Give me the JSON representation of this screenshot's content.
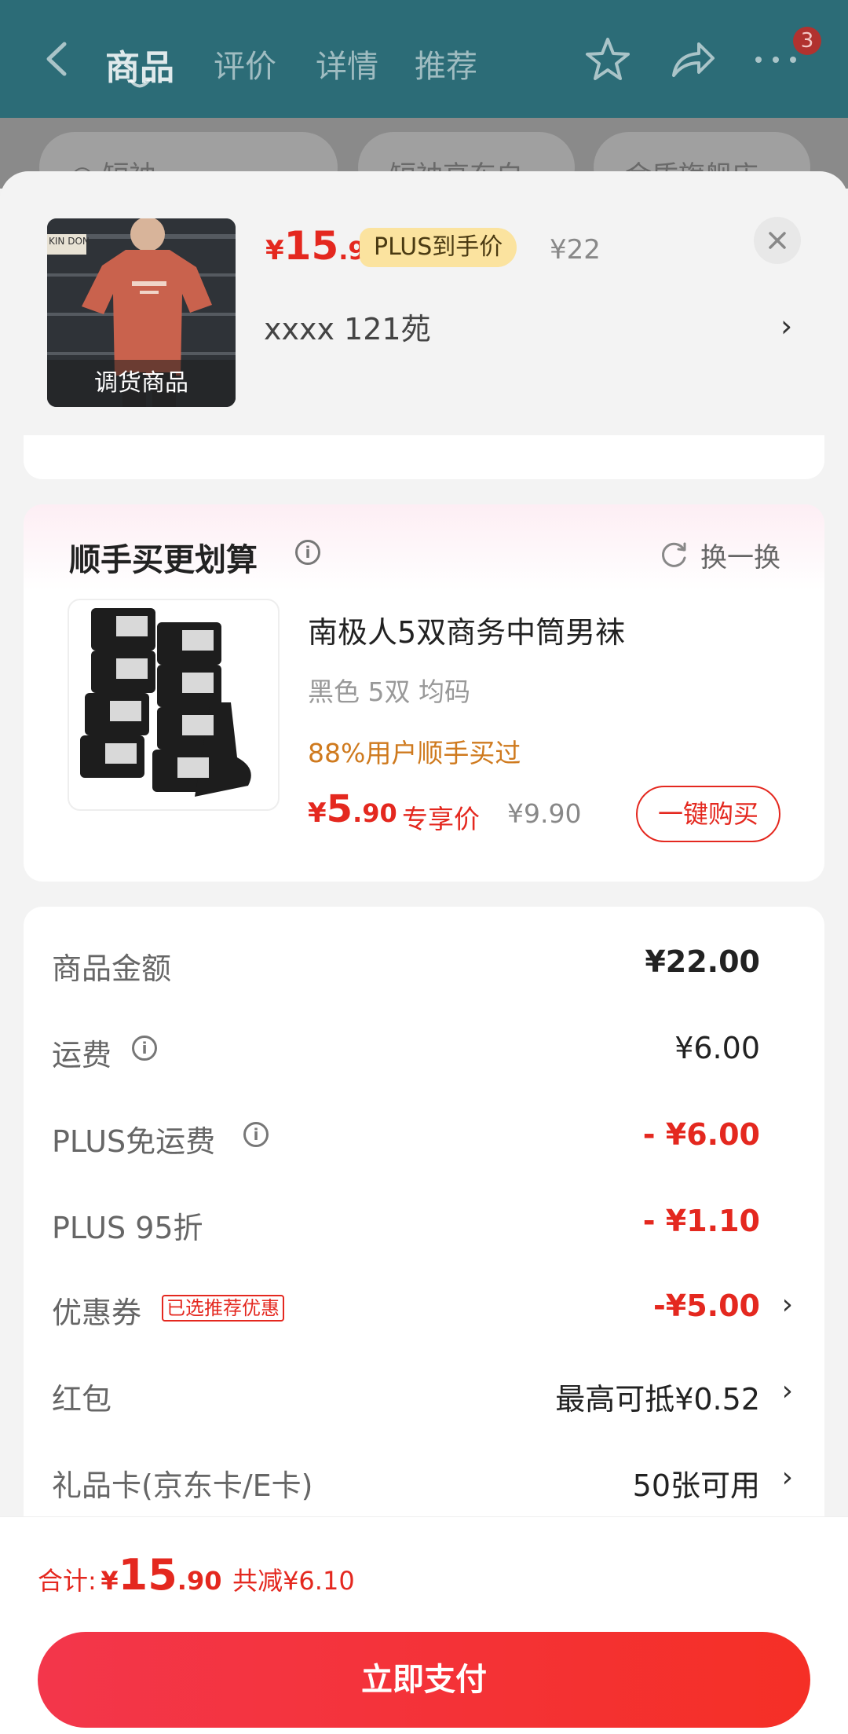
{
  "header": {
    "tabs": [
      {
        "label": "商品",
        "active": true
      },
      {
        "label": "评价"
      },
      {
        "label": "详情"
      },
      {
        "label": "推荐"
      }
    ],
    "badge_count": "3",
    "icons": [
      "back-icon",
      "star-icon",
      "share-icon",
      "more-icon"
    ]
  },
  "background_chips": [
    "短袖",
    "短袖高东白",
    "金质旗舰店"
  ],
  "product": {
    "thumb_caption": "调货商品",
    "thumb_brand": "KIN DON",
    "price_symbol": "¥",
    "price_int": "15",
    "price_dec": ".9",
    "plus_label": "PLUS到手价",
    "orig_price": "¥22",
    "spec": "xxxx  121苑",
    "spec_arrow": "›"
  },
  "addon": {
    "title": "顺手买更划算",
    "swap_label": "换一换",
    "name": "南极人5双商务中筒男袜",
    "spec": "黑色 5双   均码",
    "hint": "88%用户顺手买过",
    "price_symbol": "¥",
    "price_int": "5",
    "price_dec": ".90",
    "exclusive_label": "专享价",
    "orig_price": "¥9.90",
    "buy_label": "一键购买"
  },
  "fees": [
    {
      "label": "商品金额",
      "value": "¥22.00",
      "style": "normal"
    },
    {
      "label": "运费",
      "value": "¥6.00",
      "info": true
    },
    {
      "label": "PLUS免运费",
      "value": "- ¥6.00",
      "style": "red",
      "info": true
    },
    {
      "label": "PLUS 95折",
      "value": "- ¥1.10",
      "style": "red"
    },
    {
      "label": "优惠券",
      "tag": "已选推荐优惠",
      "value": "-¥5.00",
      "style": "red",
      "arrow": true
    },
    {
      "label": "红包",
      "value": "最高可抵¥0.52",
      "arrow": true
    },
    {
      "label": "礼品卡(京东卡/E卡)",
      "value": "50张可用",
      "arrow": true
    }
  ],
  "footer": {
    "total_label": "合计:",
    "price_symbol": "¥",
    "price_int": "15",
    "price_dec": ".90",
    "saving": "共减¥6.10",
    "pay_label": "立即支付"
  },
  "colors": {
    "header_bg": "#2c6c77",
    "accent_red": "#e4281f",
    "plus_gold": "#fbe39f",
    "hint_orange": "#cf7a1e"
  }
}
